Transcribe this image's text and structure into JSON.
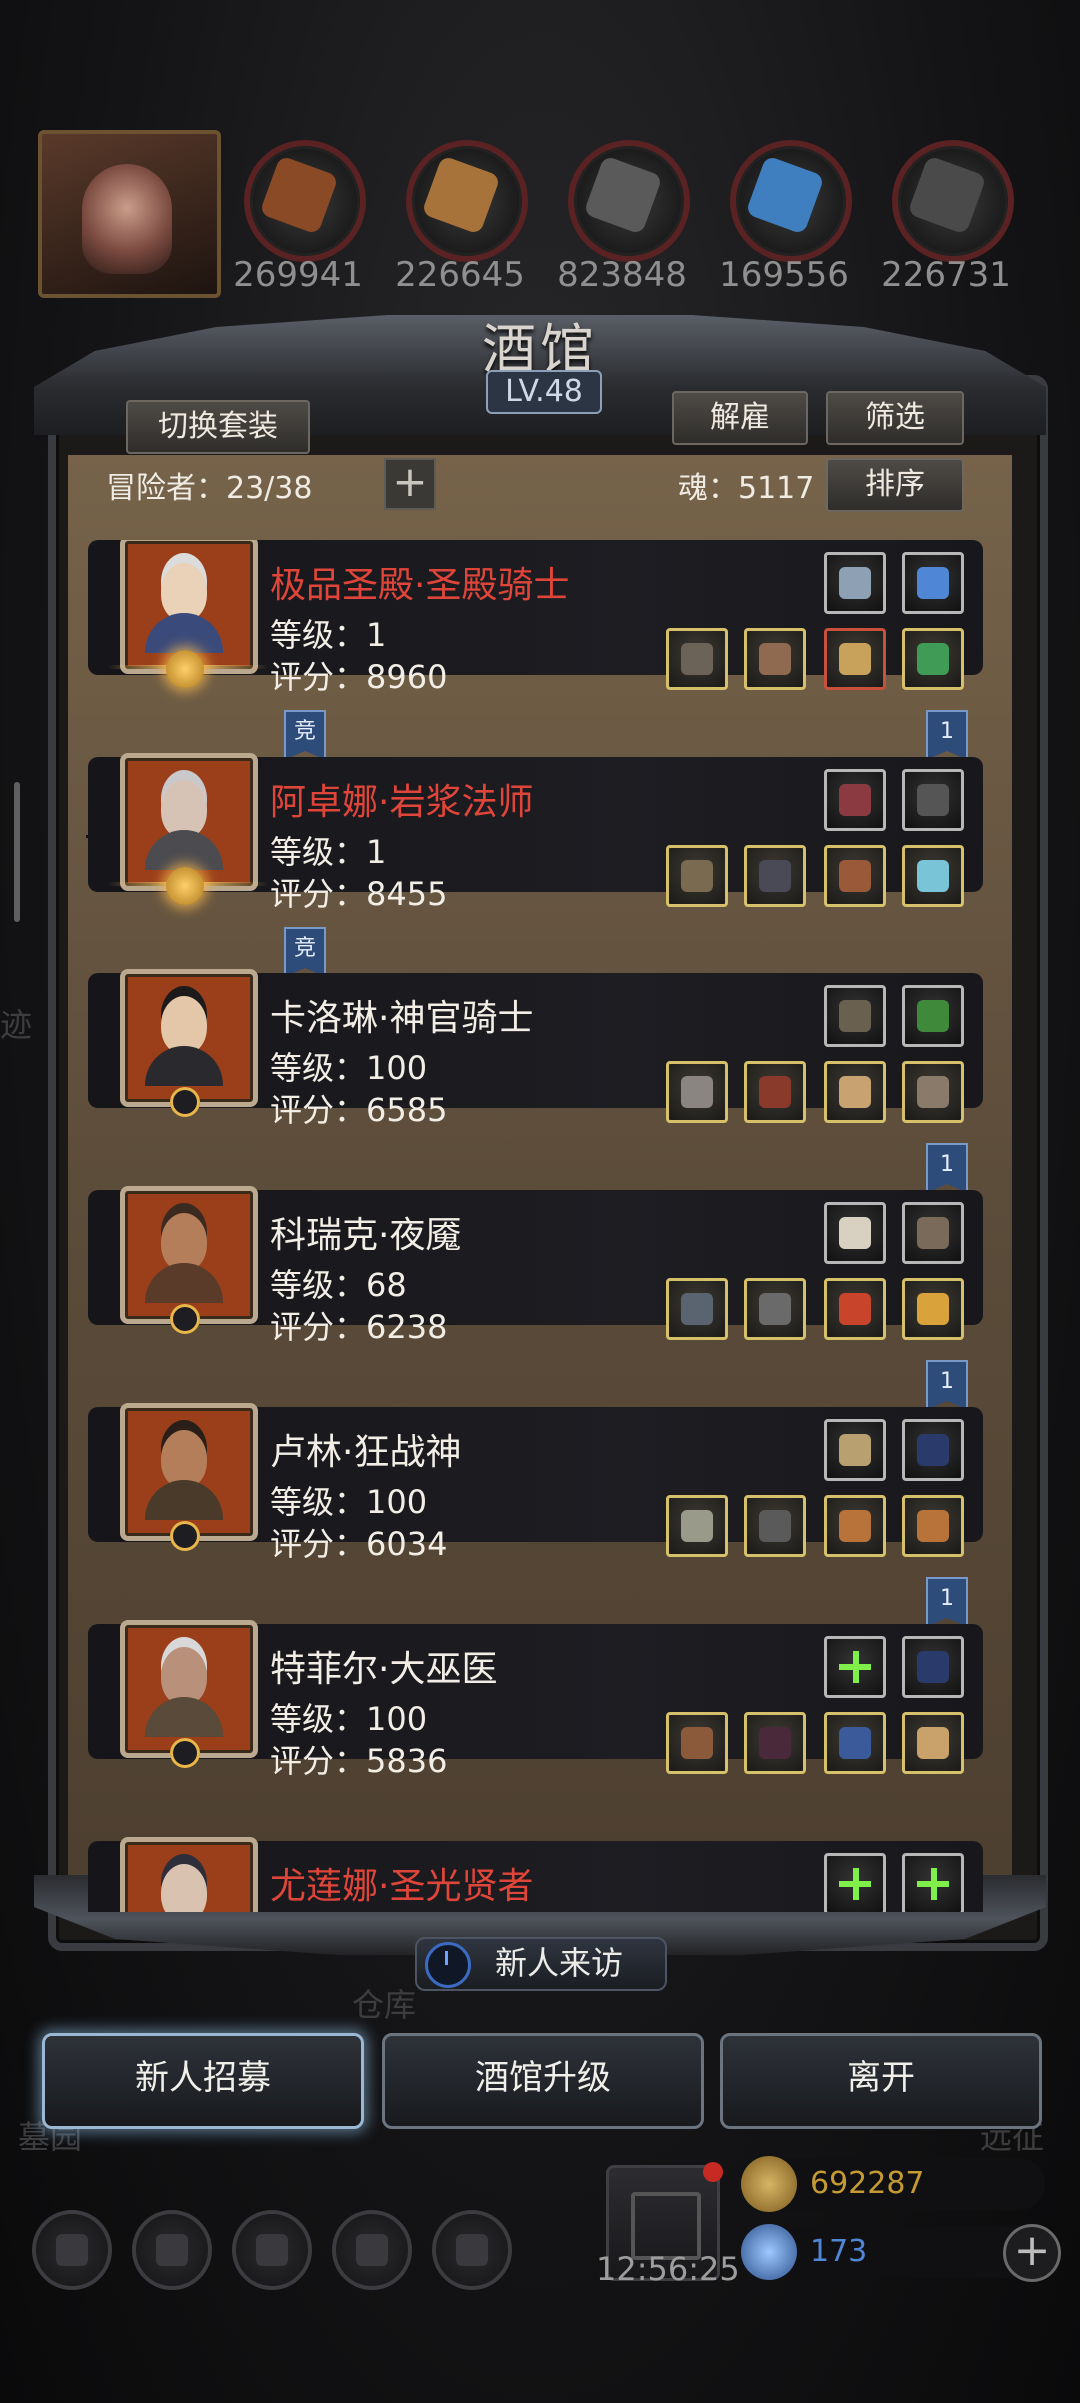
{
  "resources": [
    {
      "name": "meat",
      "value": "269941",
      "color": "#8b4a26"
    },
    {
      "name": "wood",
      "value": "226645",
      "color": "#a8733a"
    },
    {
      "name": "stone",
      "value": "823848",
      "color": "#5a5a5a"
    },
    {
      "name": "crystal",
      "value": "169556",
      "color": "#3f7fbf"
    },
    {
      "name": "iron",
      "value": "226731",
      "color": "#4a4a4a"
    }
  ],
  "tavern": {
    "title": "酒馆",
    "level": "LV.48",
    "switch_outfit": "切换套装",
    "dismiss": "解雇",
    "filter": "筛选",
    "sort": "排序",
    "adventurers_label": "冒险者：23/38",
    "plus": "+",
    "souls_label": "魂：5117"
  },
  "heroes": [
    {
      "name": "极品圣殿·圣殿骑士",
      "name_color": "red",
      "level": "等级：1",
      "score": "评分：8960",
      "tag": "竞",
      "bookmark": "1",
      "skin": "#e9d2b8",
      "hair": "#dcdcdc",
      "armor": "#3a4a7a"
    },
    {
      "name": "阿卓娜·岩浆法师",
      "name_color": "red",
      "level": "等级：1",
      "score": "评分：8455",
      "tag": "竞",
      "bookmark": "",
      "skin": "#d7c3b6",
      "hair": "#c9c9cc",
      "armor": "#4b4b50"
    },
    {
      "name": "卡洛琳·神官骑士",
      "name_color": "white",
      "level": "等级：100",
      "score": "评分：6585",
      "tag": "",
      "bookmark": "1",
      "skin": "#e4c7a8",
      "hair": "#1c1a1a",
      "armor": "#2a2a2e"
    },
    {
      "name": "科瑞克·夜魇",
      "name_color": "white",
      "level": "等级：68",
      "score": "评分：6238",
      "tag": "",
      "bookmark": "1",
      "skin": "#b47e5a",
      "hair": "#3a2a20",
      "armor": "#5a3a28"
    },
    {
      "name": "卢林·狂战神",
      "name_color": "white",
      "level": "等级：100",
      "score": "评分：6034",
      "tag": "",
      "bookmark": "1",
      "skin": "#b47e5a",
      "hair": "#2a1f18",
      "armor": "#4a3a2a"
    },
    {
      "name": "特菲尔·大巫医",
      "name_color": "white",
      "level": "等级：100",
      "score": "评分：5836",
      "tag": "",
      "bookmark": "",
      "skin": "#b9907a",
      "hair": "#d8d8d8",
      "armor": "#5a4a3a"
    },
    {
      "name": "尤莲娜·圣光贤者",
      "name_color": "red",
      "level": "",
      "score": "",
      "tag": "",
      "bookmark": "",
      "skin": "#d9c2b0",
      "hair": "#2e2e3a",
      "armor": "#3a3a4a"
    }
  ],
  "bottom": {
    "new_visitor": "新人来访",
    "recruit": "新人招募",
    "upgrade": "酒馆升级",
    "leave": "离开",
    "timer": "12:56:25",
    "gold": "692287",
    "gems": "173",
    "add": "+",
    "bg_warehouse": "仓库",
    "bg_cemetery": "墓园",
    "bg_expedition": "远征",
    "bg_trace": "迹"
  },
  "colors": {
    "accent_red": "#e0453a",
    "gold": "#d6c06a",
    "gold_text": "#c59a33",
    "gem_text": "#4f86d6"
  }
}
